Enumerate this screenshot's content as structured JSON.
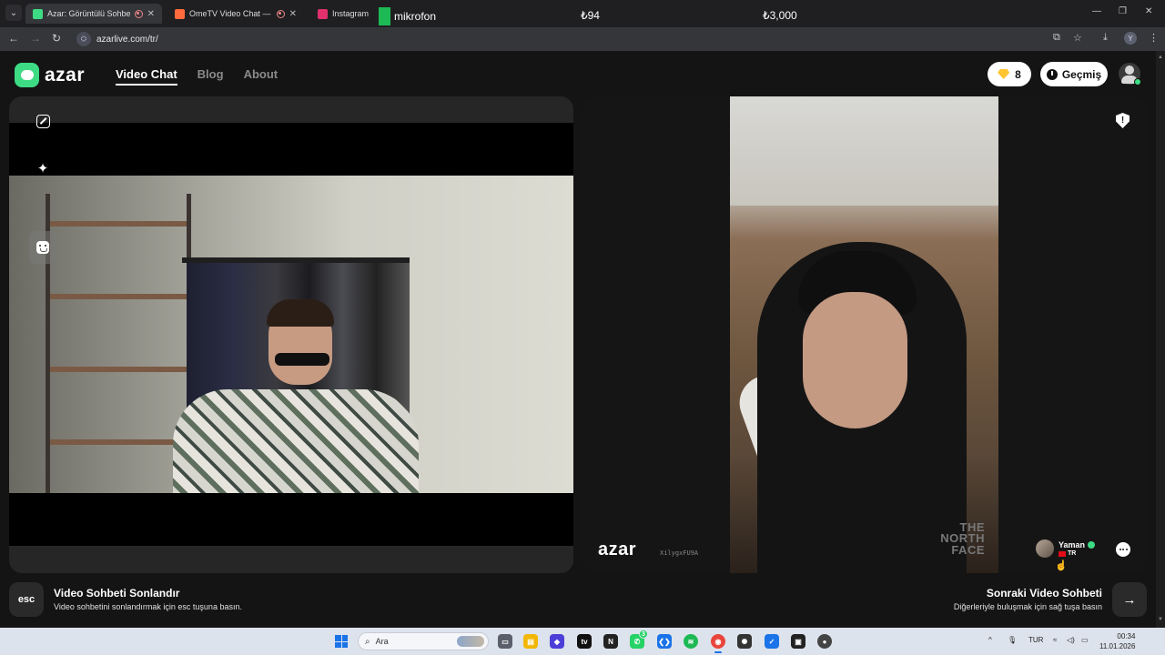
{
  "browser": {
    "tabs": [
      {
        "title": "Azar: Görüntülü Sohbet & V",
        "favicon_color": "#3ddc84",
        "recording": true,
        "active": true
      },
      {
        "title": "OmeTV Video Chat — Ome",
        "favicon_color": "#ff6b3d",
        "recording": true,
        "active": false
      },
      {
        "title": "Instagram",
        "favicon_color": "#e1306c",
        "recording": false,
        "active": false
      }
    ],
    "overlay": {
      "label": "mikrofon",
      "price_left": "₺94",
      "price_right": "₺3,000"
    },
    "url": "azarlive.com/tr/",
    "profile_initial": "Y"
  },
  "header": {
    "logo": "azar",
    "nav": [
      {
        "label": "Video Chat",
        "active": true
      },
      {
        "label": "Blog",
        "active": false
      },
      {
        "label": "About",
        "active": false
      }
    ],
    "gems": "8",
    "history_label": "Geçmiş"
  },
  "partner": {
    "watermark_logo": "azar",
    "watermark_id": "XilygxFU9A",
    "name": "Yaman",
    "country": "TR",
    "shirt_text": "THE NORTH FACE"
  },
  "controls": {
    "end_key": "esc",
    "end_title": "Video Sohbeti Sonlandır",
    "end_sub": "Video sohbetini sonlandırmak için esc tuşuna basın.",
    "next_title": "Sonraki Video Sohbeti",
    "next_sub": "Diğerleriyle buluşmak için sağ tuşa basın",
    "next_arrow": "→"
  },
  "taskbar": {
    "search_placeholder": "Ara",
    "language": "TUR",
    "time": "00:34",
    "date": "11.01.2026",
    "whatsapp_badge": "3"
  },
  "colors": {
    "brand_green": "#3ddc84",
    "gem_yellow": "#ffc531",
    "page_bg": "#141414"
  }
}
